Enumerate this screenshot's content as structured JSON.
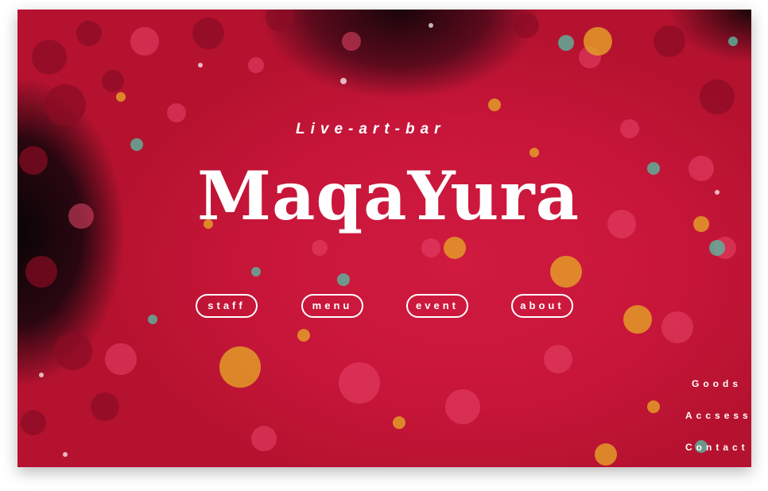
{
  "hero": {
    "tagline": "Live-art-bar",
    "logo_text": "MaqaYura"
  },
  "nav": {
    "staff": "staff",
    "menu": "menu",
    "event": "event",
    "about": "about"
  },
  "side_links": {
    "goods": "Goods",
    "access": "Accsess",
    "contact": "Contact"
  },
  "colors": {
    "background": "#c8163a",
    "text": "#ffffff"
  }
}
